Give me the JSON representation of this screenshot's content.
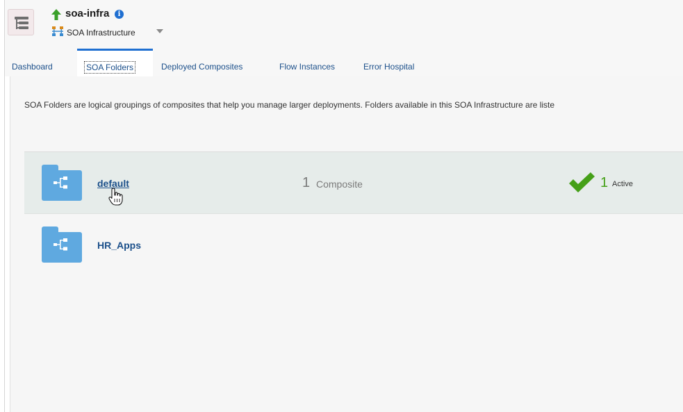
{
  "header": {
    "title": "soa-infra",
    "subtitle": "SOA Infrastructure",
    "icons": {
      "nav": "navigator-toggle-icon",
      "status": "up-arrow-icon",
      "info": "info-icon",
      "target": "soa-infrastructure-icon"
    },
    "info_glyph": "i"
  },
  "tabs": [
    {
      "label": "Dashboard",
      "active": false
    },
    {
      "label": "SOA Folders",
      "active": true
    },
    {
      "label": "Deployed Composites",
      "active": false
    },
    {
      "label": "Flow Instances",
      "active": false
    },
    {
      "label": "Error Hospital",
      "active": false
    }
  ],
  "description": "SOA Folders are logical groupings of composites that help you manage larger deployments. Folders available in this SOA Infrastructure are liste",
  "folders": [
    {
      "name": "default",
      "composite_count": "1",
      "composite_label": "Composite",
      "active_count": "1",
      "active_label": "Active",
      "hovered": true
    },
    {
      "name": "HR_Apps"
    }
  ],
  "colors": {
    "accent": "#1f6fd1",
    "link": "#1b4f8a",
    "folder": "#5fa9e0",
    "active_green": "#45a018",
    "up_green": "#3aa02a"
  }
}
